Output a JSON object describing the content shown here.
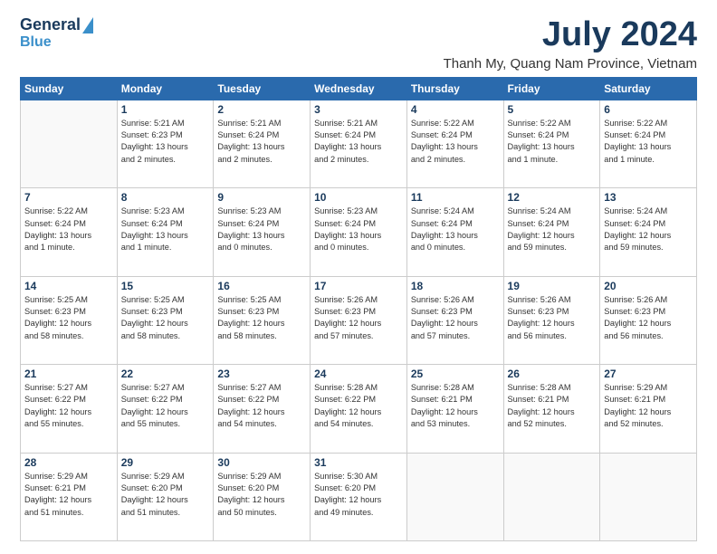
{
  "header": {
    "logo_line1": "General",
    "logo_line2": "Blue",
    "month": "July 2024",
    "location": "Thanh My, Quang Nam Province, Vietnam"
  },
  "weekdays": [
    "Sunday",
    "Monday",
    "Tuesday",
    "Wednesday",
    "Thursday",
    "Friday",
    "Saturday"
  ],
  "weeks": [
    [
      {
        "day": "",
        "info": ""
      },
      {
        "day": "1",
        "info": "Sunrise: 5:21 AM\nSunset: 6:23 PM\nDaylight: 13 hours\nand 2 minutes."
      },
      {
        "day": "2",
        "info": "Sunrise: 5:21 AM\nSunset: 6:24 PM\nDaylight: 13 hours\nand 2 minutes."
      },
      {
        "day": "3",
        "info": "Sunrise: 5:21 AM\nSunset: 6:24 PM\nDaylight: 13 hours\nand 2 minutes."
      },
      {
        "day": "4",
        "info": "Sunrise: 5:22 AM\nSunset: 6:24 PM\nDaylight: 13 hours\nand 2 minutes."
      },
      {
        "day": "5",
        "info": "Sunrise: 5:22 AM\nSunset: 6:24 PM\nDaylight: 13 hours\nand 1 minute."
      },
      {
        "day": "6",
        "info": "Sunrise: 5:22 AM\nSunset: 6:24 PM\nDaylight: 13 hours\nand 1 minute."
      }
    ],
    [
      {
        "day": "7",
        "info": "Sunrise: 5:22 AM\nSunset: 6:24 PM\nDaylight: 13 hours\nand 1 minute."
      },
      {
        "day": "8",
        "info": "Sunrise: 5:23 AM\nSunset: 6:24 PM\nDaylight: 13 hours\nand 1 minute."
      },
      {
        "day": "9",
        "info": "Sunrise: 5:23 AM\nSunset: 6:24 PM\nDaylight: 13 hours\nand 0 minutes."
      },
      {
        "day": "10",
        "info": "Sunrise: 5:23 AM\nSunset: 6:24 PM\nDaylight: 13 hours\nand 0 minutes."
      },
      {
        "day": "11",
        "info": "Sunrise: 5:24 AM\nSunset: 6:24 PM\nDaylight: 13 hours\nand 0 minutes."
      },
      {
        "day": "12",
        "info": "Sunrise: 5:24 AM\nSunset: 6:24 PM\nDaylight: 12 hours\nand 59 minutes."
      },
      {
        "day": "13",
        "info": "Sunrise: 5:24 AM\nSunset: 6:24 PM\nDaylight: 12 hours\nand 59 minutes."
      }
    ],
    [
      {
        "day": "14",
        "info": "Sunrise: 5:25 AM\nSunset: 6:23 PM\nDaylight: 12 hours\nand 58 minutes."
      },
      {
        "day": "15",
        "info": "Sunrise: 5:25 AM\nSunset: 6:23 PM\nDaylight: 12 hours\nand 58 minutes."
      },
      {
        "day": "16",
        "info": "Sunrise: 5:25 AM\nSunset: 6:23 PM\nDaylight: 12 hours\nand 58 minutes."
      },
      {
        "day": "17",
        "info": "Sunrise: 5:26 AM\nSunset: 6:23 PM\nDaylight: 12 hours\nand 57 minutes."
      },
      {
        "day": "18",
        "info": "Sunrise: 5:26 AM\nSunset: 6:23 PM\nDaylight: 12 hours\nand 57 minutes."
      },
      {
        "day": "19",
        "info": "Sunrise: 5:26 AM\nSunset: 6:23 PM\nDaylight: 12 hours\nand 56 minutes."
      },
      {
        "day": "20",
        "info": "Sunrise: 5:26 AM\nSunset: 6:23 PM\nDaylight: 12 hours\nand 56 minutes."
      }
    ],
    [
      {
        "day": "21",
        "info": "Sunrise: 5:27 AM\nSunset: 6:22 PM\nDaylight: 12 hours\nand 55 minutes."
      },
      {
        "day": "22",
        "info": "Sunrise: 5:27 AM\nSunset: 6:22 PM\nDaylight: 12 hours\nand 55 minutes."
      },
      {
        "day": "23",
        "info": "Sunrise: 5:27 AM\nSunset: 6:22 PM\nDaylight: 12 hours\nand 54 minutes."
      },
      {
        "day": "24",
        "info": "Sunrise: 5:28 AM\nSunset: 6:22 PM\nDaylight: 12 hours\nand 54 minutes."
      },
      {
        "day": "25",
        "info": "Sunrise: 5:28 AM\nSunset: 6:21 PM\nDaylight: 12 hours\nand 53 minutes."
      },
      {
        "day": "26",
        "info": "Sunrise: 5:28 AM\nSunset: 6:21 PM\nDaylight: 12 hours\nand 52 minutes."
      },
      {
        "day": "27",
        "info": "Sunrise: 5:29 AM\nSunset: 6:21 PM\nDaylight: 12 hours\nand 52 minutes."
      }
    ],
    [
      {
        "day": "28",
        "info": "Sunrise: 5:29 AM\nSunset: 6:21 PM\nDaylight: 12 hours\nand 51 minutes."
      },
      {
        "day": "29",
        "info": "Sunrise: 5:29 AM\nSunset: 6:20 PM\nDaylight: 12 hours\nand 51 minutes."
      },
      {
        "day": "30",
        "info": "Sunrise: 5:29 AM\nSunset: 6:20 PM\nDaylight: 12 hours\nand 50 minutes."
      },
      {
        "day": "31",
        "info": "Sunrise: 5:30 AM\nSunset: 6:20 PM\nDaylight: 12 hours\nand 49 minutes."
      },
      {
        "day": "",
        "info": ""
      },
      {
        "day": "",
        "info": ""
      },
      {
        "day": "",
        "info": ""
      }
    ]
  ]
}
